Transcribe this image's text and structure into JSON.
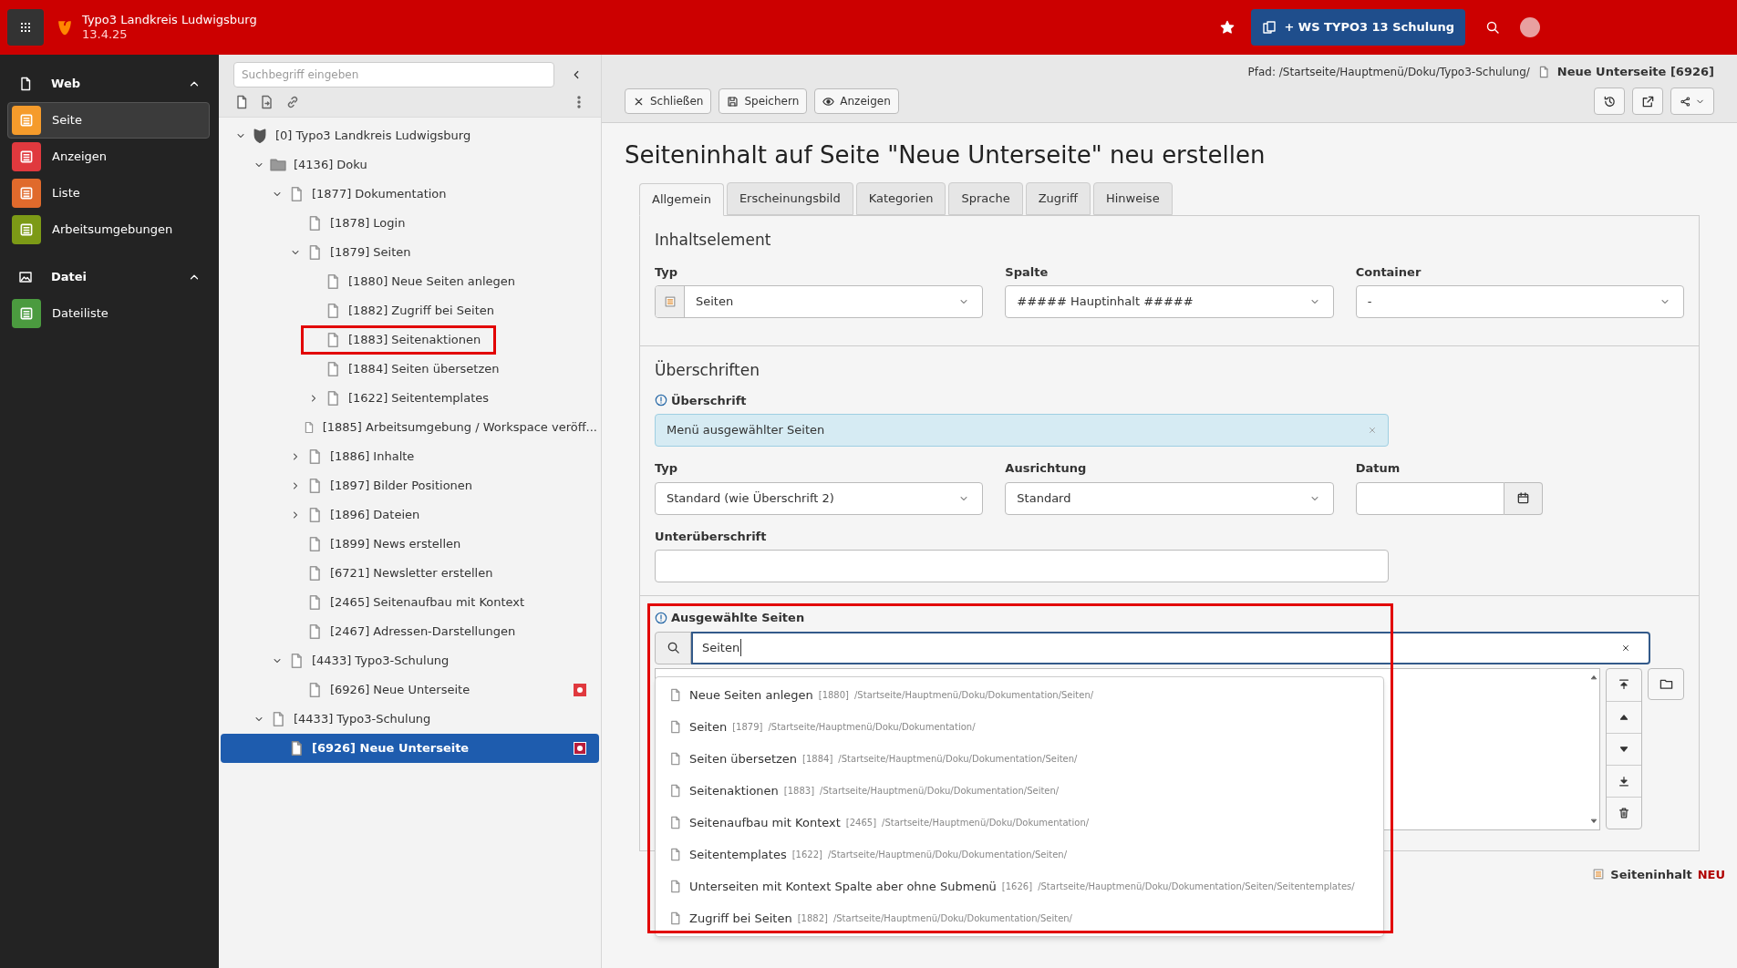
{
  "topbar": {
    "site_name": "Typo3 Landkreis Ludwigsburg",
    "version": "13.4.25",
    "workspace_button": "+ WS TYPO3 13 Schulung"
  },
  "modules": [
    {
      "kind": "group",
      "label": "Web",
      "expanded": true,
      "items": [
        {
          "label": "Seite",
          "color": "#f59b2b",
          "selected": true
        },
        {
          "label": "Anzeigen",
          "color": "#e0393e",
          "selected": false
        },
        {
          "label": "Liste",
          "color": "#e06a2c",
          "selected": false
        },
        {
          "label": "Arbeitsumgebungen",
          "color": "#7c9a16",
          "selected": false
        }
      ]
    },
    {
      "kind": "group",
      "label": "Datei",
      "expanded": true,
      "items": [
        {
          "label": "Dateiliste",
          "color": "#4b9b3f",
          "selected": false
        }
      ]
    }
  ],
  "tree_panel": {
    "search": {
      "placeholder": "Suchbegriff eingeben"
    },
    "tree": [
      {
        "label": "[0] Typo3 Landkreis Ludwigsburg",
        "kind": "root",
        "expanded": true,
        "selected": false,
        "modified": false,
        "annotated": false,
        "children": [
          {
            "label": "[4136] Doku",
            "kind": "folder",
            "expanded": true,
            "selected": false,
            "modified": false,
            "annotated": false,
            "children": [
              {
                "label": "[1877] Dokumentation",
                "kind": "page",
                "expanded": true,
                "selected": false,
                "modified": false,
                "annotated": false,
                "children": [
                  {
                    "label": "[1878] Login",
                    "kind": "page",
                    "selected": false,
                    "modified": false,
                    "annotated": false
                  },
                  {
                    "label": "[1879] Seiten",
                    "kind": "page",
                    "expanded": true,
                    "selected": false,
                    "modified": false,
                    "annotated": false,
                    "children": [
                      {
                        "label": "[1880] Neue Seiten anlegen",
                        "kind": "page",
                        "selected": false,
                        "modified": false,
                        "annotated": false
                      },
                      {
                        "label": "[1882] Zugriff bei Seiten",
                        "kind": "page",
                        "selected": false,
                        "modified": false,
                        "annotated": false
                      },
                      {
                        "label": "[1883] Seitenaktionen",
                        "kind": "page",
                        "selected": false,
                        "modified": false,
                        "annotated": true
                      },
                      {
                        "label": "[1884] Seiten übersetzen",
                        "kind": "page",
                        "selected": false,
                        "modified": false,
                        "annotated": false
                      },
                      {
                        "label": "[1622] Seitentemplates",
                        "kind": "page",
                        "expanded": false,
                        "selected": false,
                        "modified": false,
                        "annotated": false
                      }
                    ]
                  },
                  {
                    "label": "[1885] Arbeitsumgebung / Workspace veröff...",
                    "kind": "page",
                    "selected": false,
                    "modified": false,
                    "annotated": false
                  },
                  {
                    "label": "[1886] Inhalte",
                    "kind": "page",
                    "expanded": false,
                    "selected": false,
                    "modified": false,
                    "annotated": false
                  },
                  {
                    "label": "[1897] Bilder Positionen",
                    "kind": "page",
                    "expanded": false,
                    "selected": false,
                    "modified": false,
                    "annotated": false
                  },
                  {
                    "label": "[1896] Dateien",
                    "kind": "page",
                    "expanded": false,
                    "selected": false,
                    "modified": false,
                    "annotated": false
                  },
                  {
                    "label": "[1899] News erstellen",
                    "kind": "page",
                    "selected": false,
                    "modified": false,
                    "annotated": false
                  },
                  {
                    "label": "[6721] Newsletter erstellen",
                    "kind": "page",
                    "selected": false,
                    "modified": false,
                    "annotated": false
                  },
                  {
                    "label": "[2465] Seitenaufbau mit Kontext",
                    "kind": "page",
                    "selected": false,
                    "modified": false,
                    "annotated": false
                  },
                  {
                    "label": "[2467] Adressen-Darstellungen",
                    "kind": "page",
                    "selected": false,
                    "modified": false,
                    "annotated": false
                  }
                ]
              },
              {
                "label": "[4433] Typo3-Schulung",
                "kind": "page",
                "expanded": true,
                "selected": false,
                "modified": false,
                "annotated": false,
                "children": [
                  {
                    "label": "[6926] Neue Unterseite",
                    "kind": "page",
                    "selected": false,
                    "modified": true,
                    "annotated": false
                  }
                ]
              }
            ]
          },
          {
            "label": "[4433] Typo3-Schulung",
            "kind": "page",
            "expanded": true,
            "selected": false,
            "modified": false,
            "annotated": false,
            "children": [
              {
                "label": "[6926] Neue Unterseite",
                "kind": "page",
                "selected": true,
                "modified": true,
                "annotated": false
              }
            ]
          }
        ]
      }
    ]
  },
  "docheader": {
    "path_label": "Pfad: /Startseite/Hauptmenü/Doku/Typo3-Schulung/",
    "page_title": "Neue Unterseite [6926]",
    "buttons": [
      "Schließen",
      "Speichern",
      "Anzeigen"
    ]
  },
  "title": "Seiteninhalt auf Seite \"Neue Unterseite\" neu erstellen",
  "tabs": [
    {
      "label": "Allgemein",
      "selected": true
    },
    {
      "label": "Erscheinungsbild",
      "selected": false
    },
    {
      "label": "Kategorien",
      "selected": false
    },
    {
      "label": "Sprache",
      "selected": false
    },
    {
      "label": "Zugriff",
      "selected": false
    },
    {
      "label": "Hinweise",
      "selected": false
    }
  ],
  "content_element": {
    "heading": "Inhaltselement",
    "fields": [
      {
        "label": "Typ",
        "value": "Seiten",
        "has_icon": true
      },
      {
        "label": "Spalte",
        "value": "##### Hauptinhalt #####",
        "has_icon": false
      },
      {
        "label": "Container",
        "value": "-",
        "has_icon": false
      }
    ]
  },
  "headers": {
    "heading": "Überschriften",
    "header": {
      "label": "Überschrift",
      "value": "Menü ausgewählter Seiten"
    },
    "row": [
      {
        "kind": "select",
        "label": "Typ",
        "value": "Standard (wie Überschrift 2)"
      },
      {
        "kind": "select",
        "label": "Ausrichtung",
        "value": "Standard"
      },
      {
        "kind": "date",
        "label": "Datum"
      }
    ],
    "subheader": {
      "label": "Unterüberschrift"
    }
  },
  "selected_pages": {
    "label": "Ausgewählte Seiten",
    "annotated": true,
    "search_value": "Seiten",
    "results": [
      {
        "title": "Neue Seiten anlegen",
        "uid": "[1880]",
        "path": "/Startseite/Hauptmenü/Doku/Dokumentation/Seiten/"
      },
      {
        "title": "Seiten",
        "uid": "[1879]",
        "path": "/Startseite/Hauptmenü/Doku/Dokumentation/"
      },
      {
        "title": "Seiten übersetzen",
        "uid": "[1884]",
        "path": "/Startseite/Hauptmenü/Doku/Dokumentation/Seiten/"
      },
      {
        "title": "Seitenaktionen",
        "uid": "[1883]",
        "path": "/Startseite/Hauptmenü/Doku/Dokumentation/Seiten/"
      },
      {
        "title": "Seitenaufbau mit Kontext",
        "uid": "[2465]",
        "path": "/Startseite/Hauptmenü/Doku/Dokumentation/"
      },
      {
        "title": "Seitentemplates",
        "uid": "[1622]",
        "path": "/Startseite/Hauptmenü/Doku/Dokumentation/Seiten/"
      },
      {
        "title": "Unterseiten mit Kontext Spalte aber ohne Submenü",
        "uid": "[1626]",
        "path": "/Startseite/Hauptmenü/Doku/Dokumentation/Seiten/Seitentemplates/"
      },
      {
        "title": "Zugriff bei Seiten",
        "uid": "[1882]",
        "path": "/Startseite/Hauptmenü/Doku/Dokumentation/Seiten/"
      }
    ]
  },
  "footer": {
    "record_type": "Seiteninhalt",
    "state": "NEU"
  }
}
